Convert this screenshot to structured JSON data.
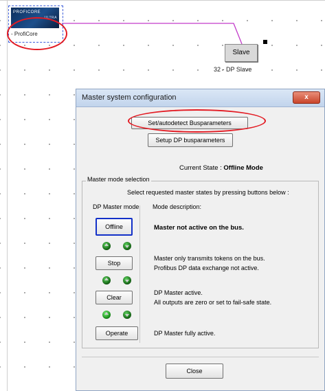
{
  "canvas": {
    "master": {
      "logo_line1": "PROFICORE",
      "logo_line2": "ULTRA",
      "label": "- ProfiCore"
    },
    "slave": {
      "button_label": "Slave",
      "label": "32 - DP Slave"
    }
  },
  "dialog": {
    "title": "Master system configuration",
    "close_glyph": "x",
    "set_autodetect_label": "Set/autodetect Busparameters",
    "setup_dp_label": "Setup DP busparameters",
    "current_state_prefix": "Current State : ",
    "current_state_value": "Offline Mode",
    "group_title": "Master mode selection",
    "instruction": "Select requested master states by pressing buttons below :",
    "dp_master_mode_header": "DP Master mode",
    "mode_description_header": "Mode description:",
    "modes": [
      {
        "label": "Offline",
        "desc_line1": "Master not active on the bus.",
        "desc_line2": ""
      },
      {
        "label": "Stop",
        "desc_line1": "Master only transmits tokens on the bus.",
        "desc_line2": "Profibus DP data exchange not active."
      },
      {
        "label": "Clear",
        "desc_line1": "DP Master active.",
        "desc_line2": "All outputs are zero or set to fail-safe state."
      },
      {
        "label": "Operate",
        "desc_line1": "DP Master fully active.",
        "desc_line2": ""
      }
    ],
    "close_label": "Close"
  },
  "colors": {
    "highlight_oval": "#e31b23",
    "connection_line": "#c23ac9",
    "selected_border": "#1230c8"
  }
}
